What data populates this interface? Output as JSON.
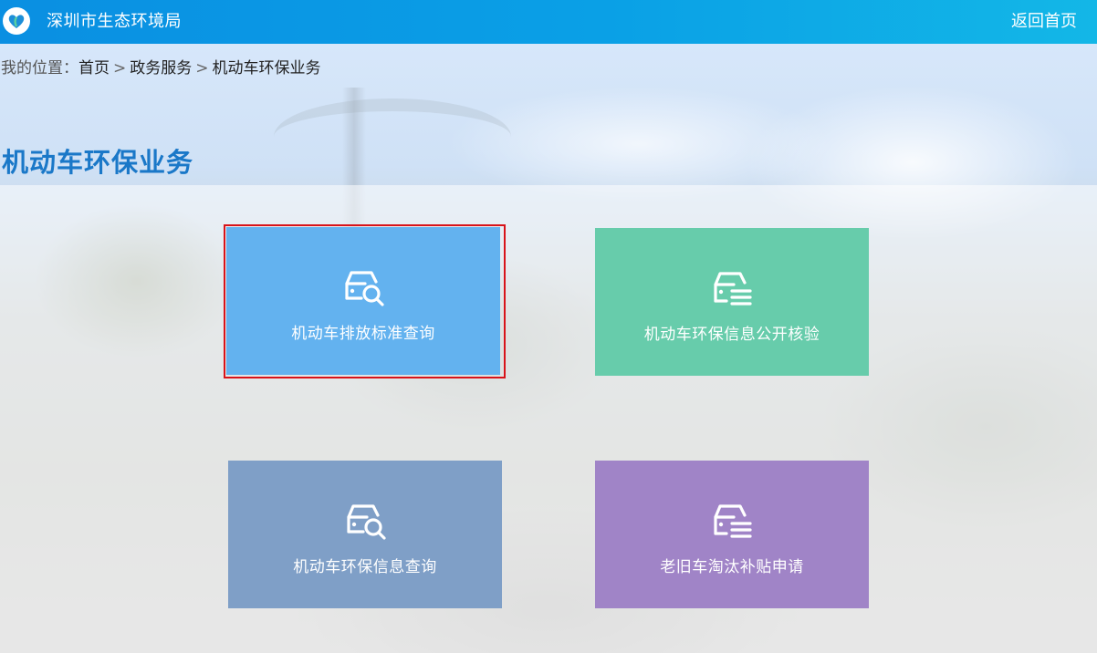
{
  "header": {
    "site_title": "深圳市生态环境局",
    "home_link": "返回首页",
    "logo_icon": "heart-logo-icon"
  },
  "breadcrumb": {
    "prefix": "我的位置：",
    "items": [
      "首页",
      "政务服务",
      "机动车环保业务"
    ],
    "separator": ">"
  },
  "page": {
    "title": "机动车环保业务"
  },
  "tiles": [
    {
      "label": "机动车排放标准查询",
      "icon": "car-search-icon",
      "color": "#63b2ef",
      "selected": true
    },
    {
      "label": "机动车环保信息公开核验",
      "icon": "car-list-icon",
      "color": "#67ccab",
      "selected": false
    },
    {
      "label": "机动车环保信息查询",
      "icon": "car-search-icon",
      "color": "#7f9fc7",
      "selected": false
    },
    {
      "label": "老旧车淘汰补贴申请",
      "icon": "car-list-icon",
      "color": "#a084c7",
      "selected": false
    }
  ],
  "colors": {
    "topbar_start": "#0a8fe2",
    "topbar_end": "#13b7e7",
    "title_blue": "#1a78c8",
    "selection_red": "#d8131a"
  }
}
